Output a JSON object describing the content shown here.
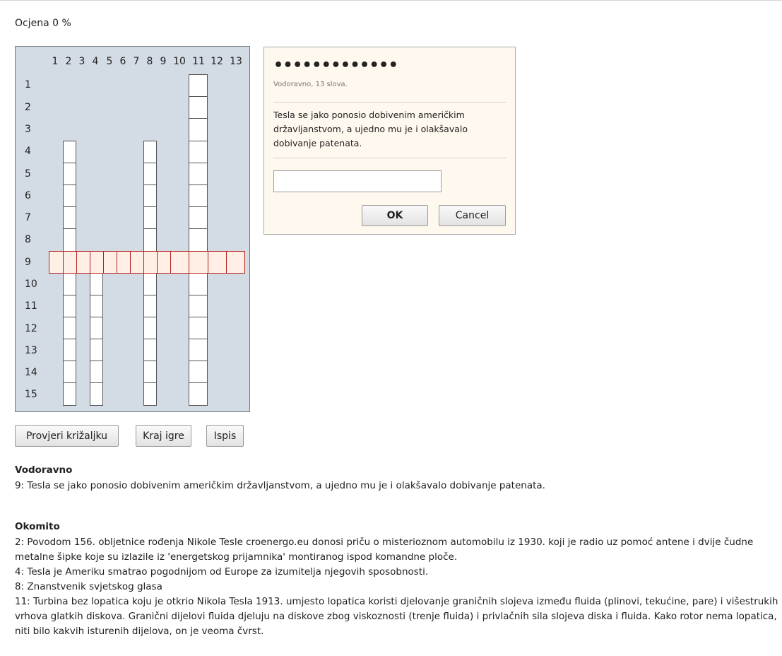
{
  "score_label": "Ocjena 0 %",
  "columns": [
    "1",
    "2",
    "3",
    "4",
    "5",
    "6",
    "7",
    "8",
    "9",
    "10",
    "11",
    "12",
    "13"
  ],
  "rows": [
    "1",
    "2",
    "3",
    "4",
    "5",
    "6",
    "7",
    "8",
    "9",
    "10",
    "11",
    "12",
    "13",
    "14",
    "15"
  ],
  "popup": {
    "mask": "•••••••••••••",
    "hint": "Vodoravno, 13 slova.",
    "clue": "Tesla se jako ponosio dobivenim američkim državljanstvom, a ujedno mu je i olakšavalo dobivanje patenata.",
    "answer_value": "",
    "ok_label": "OK",
    "cancel_label": "Cancel"
  },
  "actions": {
    "check_label": "Provjeri križaljku",
    "end_label": "Kraj igre",
    "print_label": "Ispis"
  },
  "clues": {
    "across_title": "Vodoravno",
    "across": [
      "9: Tesla se jako ponosio dobivenim američkim državljanstvom, a ujedno mu je i olakšavalo dobivanje patenata."
    ],
    "down_title": "Okomito",
    "down": [
      "2: Povodom 156. obljetnice rođenja Nikole Tesle croenergo.eu donosi priču o misterioznom automobilu iz 1930. koji je radio uz pomoć antene i dvije čudne metalne šipke koje su izlazile iz 'energetskog prijamnika' montiranog ispod komandne ploče.",
      "4: Tesla je Ameriku smatrao pogodnijom od Europe za izumitelja njegovih sposobnosti.",
      "8: Znanstvenik svjetskog glasa",
      "11: Turbina bez lopatica koju je otkrio Nikola Tesla 1913. umjesto lopatica koristi djelovanje graničnih slojeva između fluida (plinovi, tekućine, pare) i višestrukih vrhova glatkih diskova. Granični dijelovi fluida djeluju na diskove zbog viskoznosti (trenje fluida) i privlačnih sila slojeva diska i fluida. Kako rotor nema lopatica, niti bilo kakvih isturenih dijelova, on je veoma čvrst."
    ]
  }
}
